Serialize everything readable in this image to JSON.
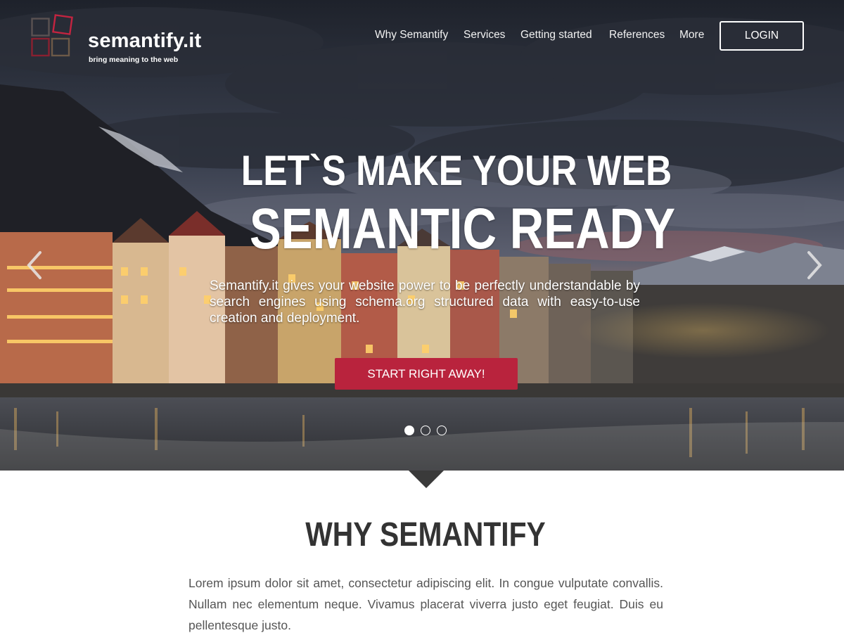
{
  "brand": {
    "name": "semantify.it",
    "tagline": "bring meaning to the web",
    "accent_color": "#b9233d"
  },
  "nav": {
    "items": [
      {
        "label": "Why Semantify"
      },
      {
        "label": "Services"
      },
      {
        "label": "Getting started"
      },
      {
        "label": "References"
      },
      {
        "label": "More"
      }
    ],
    "login_label": "LOGIN"
  },
  "hero": {
    "title_line1": "LET`S MAKE YOUR WEB",
    "title_line2": "SEMANTIC READY",
    "description": "Semantify.it gives your website power to be perfectly understandable by search engines using schema.org structured data with easy-to-use creation and deployment.",
    "cta_label": "START RIGHT AWAY!",
    "prev_icon": "chevron-left-icon",
    "next_icon": "chevron-right-icon",
    "slides": {
      "count": 3,
      "active": 1
    }
  },
  "why": {
    "title": "WHY SEMANTIFY",
    "body": "Lorem ipsum dolor sit amet, consectetur adipiscing elit. In congue vulputate convallis. Nullam nec elementum neque. Vivamus placerat viverra justo eget feugiat. Duis eu pellentesque justo."
  }
}
